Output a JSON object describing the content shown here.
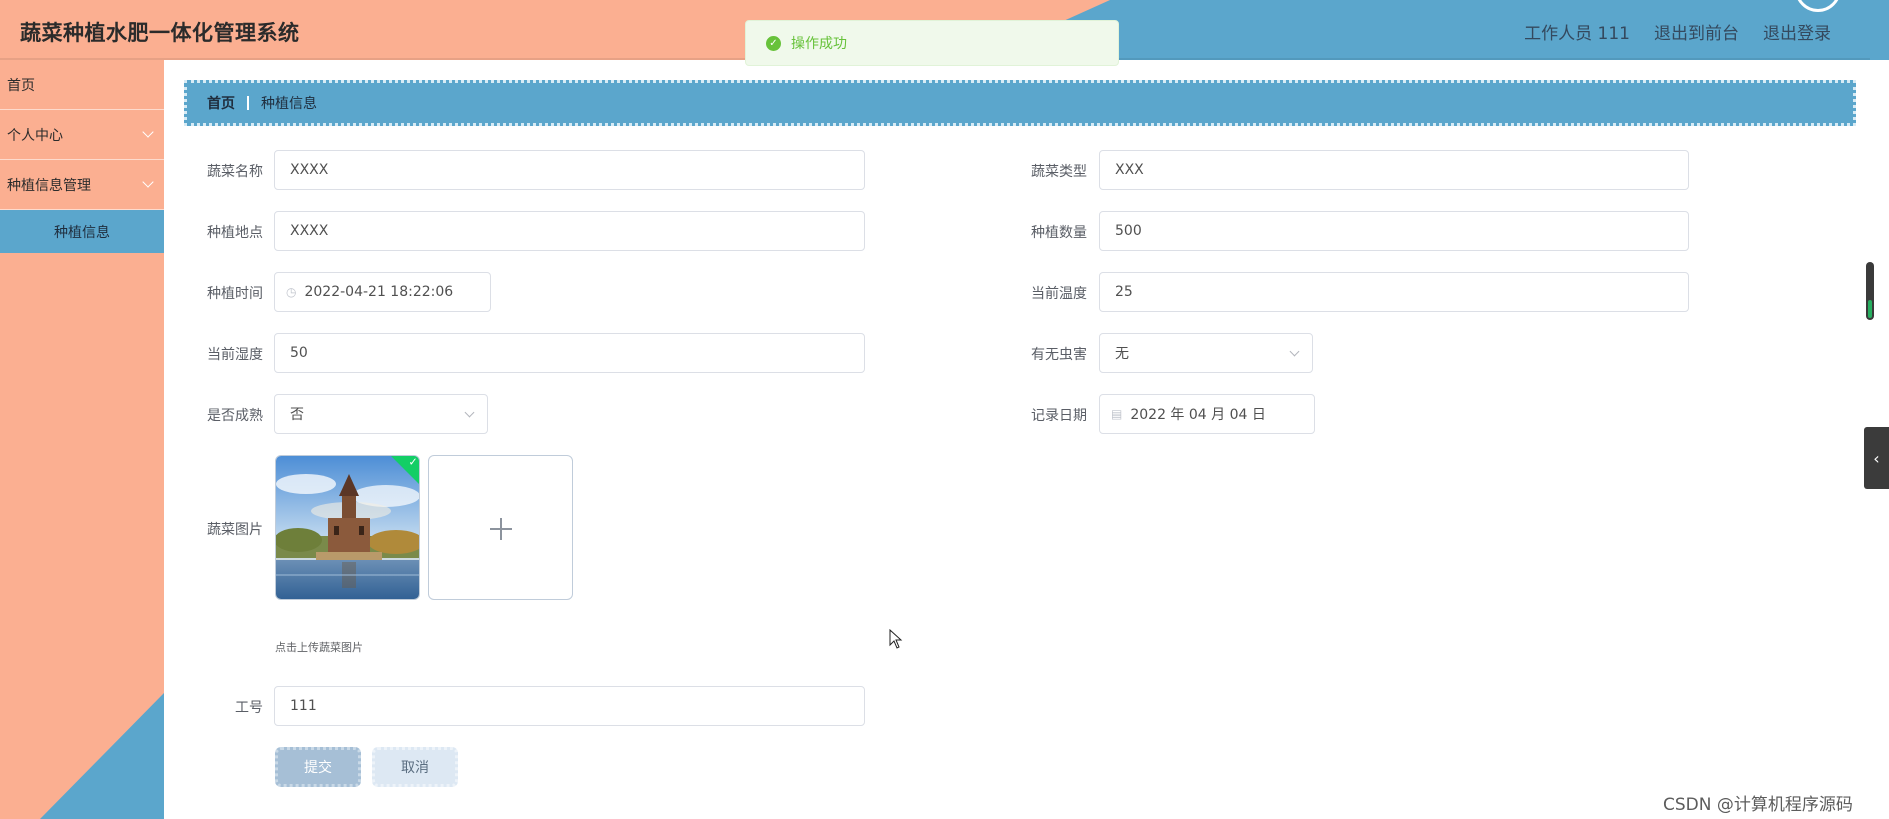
{
  "header": {
    "title": "蔬菜种植水肥一体化管理系统",
    "user_label": "工作人员 111",
    "to_front_label": "退出到前台",
    "logout_label": "退出登录"
  },
  "toast": {
    "text": "操作成功"
  },
  "sidebar": {
    "items": [
      {
        "label": "首页"
      },
      {
        "label": "个人中心"
      },
      {
        "label": "种植信息管理"
      }
    ],
    "subitem": {
      "label": "种植信息"
    }
  },
  "breadcrumb": {
    "home": "首页",
    "current": "种植信息"
  },
  "form": {
    "name": {
      "label": "蔬菜名称",
      "value": "XXXX"
    },
    "type": {
      "label": "蔬菜类型",
      "value": "XXX"
    },
    "location": {
      "label": "种植地点",
      "value": "XXXX"
    },
    "quantity": {
      "label": "种植数量",
      "value": "500"
    },
    "plant_time": {
      "label": "种植时间",
      "value": "2022-04-21 18:22:06"
    },
    "temperature": {
      "label": "当前温度",
      "value": "25"
    },
    "humidity": {
      "label": "当前湿度",
      "value": "50"
    },
    "pests": {
      "label": "有无虫害",
      "value": "无"
    },
    "mature": {
      "label": "是否成熟",
      "value": "否"
    },
    "record_date": {
      "label": "记录日期",
      "value": "2022 年 04 月 04 日"
    },
    "image": {
      "label": "蔬菜图片",
      "hint": "点击上传蔬菜图片"
    },
    "worker_id": {
      "label": "工号",
      "value": "111"
    },
    "submit_label": "提交",
    "cancel_label": "取消"
  },
  "watermark": "CSDN @计算机程序源码",
  "colors": {
    "peach": "#fbaf91",
    "blue": "#5ba6cc",
    "success": "#67c23a",
    "submit": "#a6bfd6"
  }
}
